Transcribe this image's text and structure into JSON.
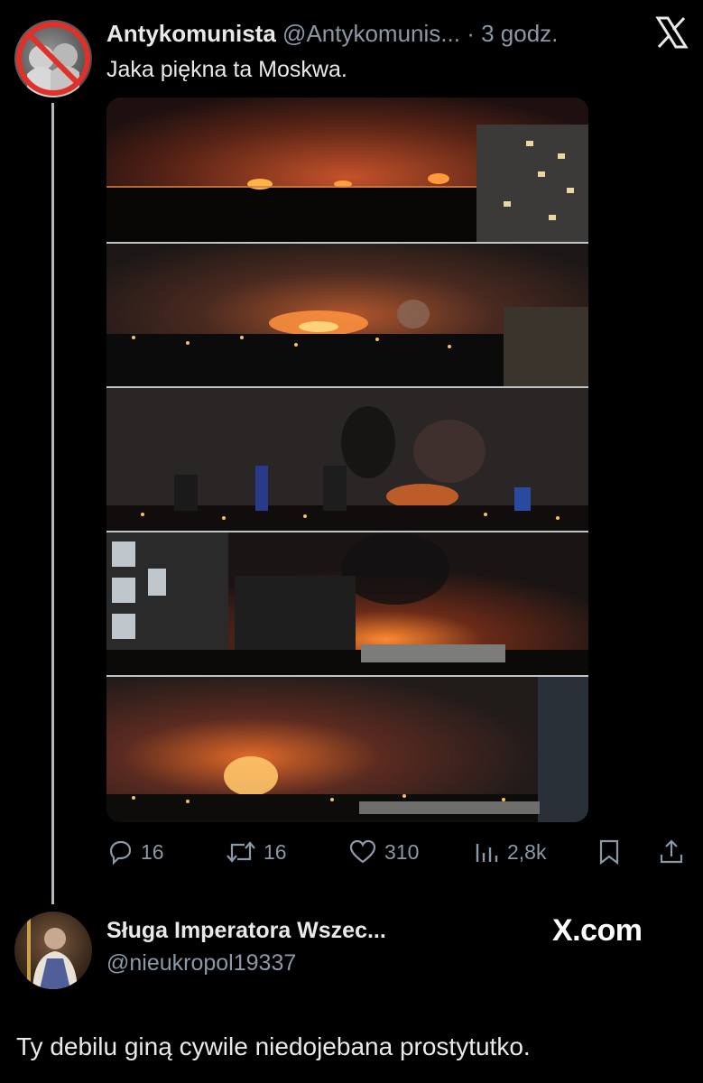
{
  "tweet1": {
    "author_name": "Antykomunista",
    "author_handle": "@Antykomunis...",
    "separator": "·",
    "time": "3 godz.",
    "text": "Jaka piękna ta Moskwa.",
    "media_panels": [
      "fire-photo-1",
      "fire-photo-2",
      "fire-photo-3",
      "fire-photo-4",
      "fire-photo-5"
    ],
    "actions": {
      "replies": "16",
      "reposts": "16",
      "likes": "310",
      "views": "2,8k"
    }
  },
  "tweet2": {
    "author_name": "Sługa Imperatora Wszec...",
    "author_handle": "@nieukropol19337",
    "source_label": "X.com",
    "text": "Ty debilu giną cywile niedojebana prostytutko."
  },
  "colors": {
    "background": "#000000",
    "text_primary": "#e7e9ea",
    "text_secondary": "#8b98a5",
    "thread_line": "#cfd9de"
  },
  "icons": [
    "x-logo-icon",
    "reply-icon",
    "repost-icon",
    "like-icon",
    "views-icon",
    "bookmark-icon",
    "share-icon"
  ]
}
